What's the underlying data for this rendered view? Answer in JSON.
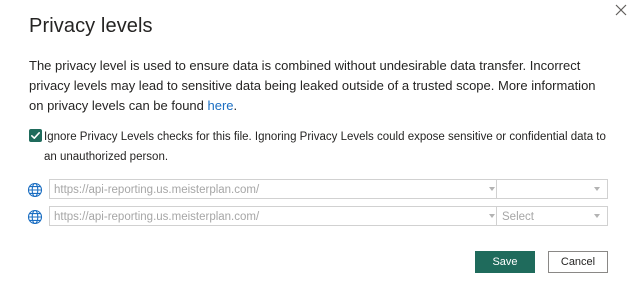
{
  "dialog": {
    "title": "Privacy levels",
    "description_text": "The privacy level is used to ensure data is combined without undesirable data transfer. Incorrect privacy levels may lead to sensitive data being leaked outside of a trusted scope. More information on privacy levels can be found ",
    "description_link": "here",
    "description_end": ".",
    "close_icon": "close-icon"
  },
  "ignore_checkbox": {
    "checked": true,
    "label": "Ignore Privacy Levels checks for this file. Ignoring Privacy Levels could expose sensitive or confidential data to an unauthorized person."
  },
  "sources": [
    {
      "icon": "globe-icon",
      "url": "https://api-reporting.us.meisterplan.com/",
      "level": ""
    },
    {
      "icon": "globe-icon",
      "url": "https://api-reporting.us.meisterplan.com/",
      "level": "Select"
    }
  ],
  "buttons": {
    "save": "Save",
    "cancel": "Cancel"
  },
  "colors": {
    "accent": "#1f6b5c",
    "link": "#1b6ec2",
    "text": "#252423",
    "placeholder": "#a6a6a6",
    "border": "#d1d1d1"
  }
}
